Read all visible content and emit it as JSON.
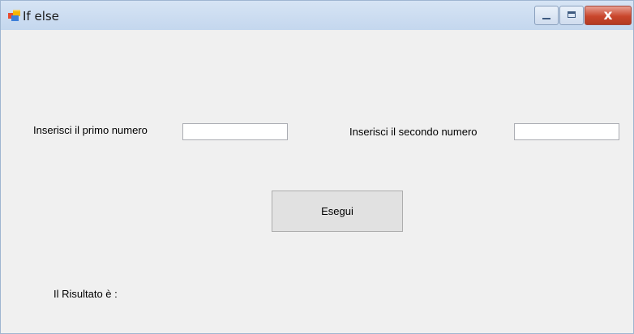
{
  "window": {
    "title": "If else",
    "icon": "winforms-app-icon",
    "controls": {
      "minimize_icon": "minimize-icon",
      "maximize_icon": "maximize-icon",
      "close_icon": "close-icon",
      "close_glyph": "x"
    }
  },
  "form": {
    "first_label": "Inserisci il primo numero",
    "first_value": "",
    "second_label": "Inserisci il secondo numero",
    "second_value": "",
    "run_button_label": "Esegui",
    "result_label": "Il Risultato è :"
  },
  "colors": {
    "titlebar": "#c4d7ee",
    "client_background": "#f0f0f0",
    "close_button": "#c9462c",
    "button_face": "#e1e1e1"
  }
}
